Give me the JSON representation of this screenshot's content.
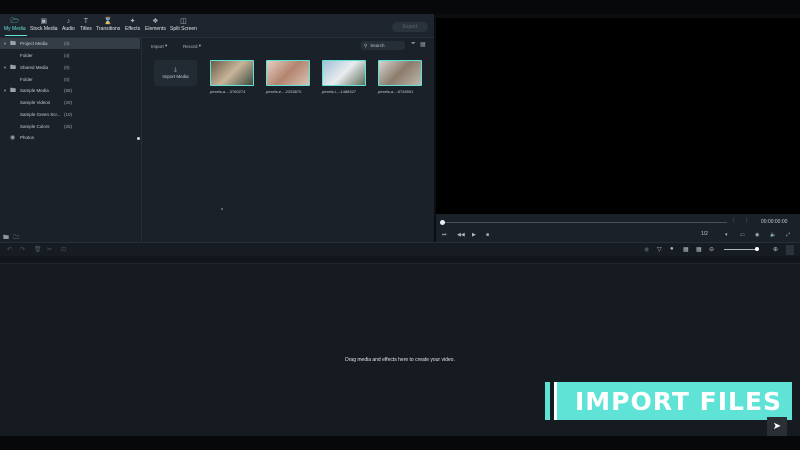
{
  "tabs": [
    {
      "label": "My Media",
      "icon": "folder-icon"
    },
    {
      "label": "Stock Media",
      "icon": "film-icon"
    },
    {
      "label": "Audio",
      "icon": "music-note-icon"
    },
    {
      "label": "Titles",
      "icon": "text-icon"
    },
    {
      "label": "Transitions",
      "icon": "transition-icon"
    },
    {
      "label": "Effects",
      "icon": "effects-icon"
    },
    {
      "label": "Elements",
      "icon": "elements-icon"
    },
    {
      "label": "Split Screen",
      "icon": "split-screen-icon"
    }
  ],
  "export_label": "Export",
  "tree": [
    {
      "label": "Project Media",
      "count": "(4)",
      "selected": true,
      "indent": 0
    },
    {
      "label": "Folder",
      "count": "(4)",
      "selected": false,
      "indent": 1
    },
    {
      "label": "Shared Media",
      "count": "(0)",
      "selected": false,
      "indent": 0
    },
    {
      "label": "Folder",
      "count": "(0)",
      "selected": false,
      "indent": 1
    },
    {
      "label": "Sample Media",
      "count": "(55)",
      "selected": false,
      "indent": 0
    },
    {
      "label": "Sample Videos",
      "count": "(20)",
      "selected": false,
      "indent": 1
    },
    {
      "label": "Sample Green Scr...",
      "count": "(10)",
      "selected": false,
      "indent": 1
    },
    {
      "label": "Sample Colors",
      "count": "(25)",
      "selected": false,
      "indent": 1
    },
    {
      "label": "Photos",
      "count": "",
      "selected": false,
      "indent": 0
    }
  ],
  "browser": {
    "import_label": "Import",
    "record_label": "Record",
    "search_placeholder": "Search",
    "import_tile_label": "Import Media",
    "items": [
      {
        "label": "pexels-a...-3760274",
        "colors": [
          "#6b5a48",
          "#c8b59a",
          "#3e4a3f"
        ]
      },
      {
        "label": "pexels-e...-2253870",
        "colors": [
          "#e6d0c3",
          "#b3846f",
          "#d9c2b4"
        ]
      },
      {
        "label": "pexels-l...-1488327",
        "colors": [
          "#9fc1d6",
          "#e9ecef",
          "#5e6e5a"
        ]
      },
      {
        "label": "pexels-a...-6745901",
        "colors": [
          "#d7d4cf",
          "#8c7c6c",
          "#bfb8ae"
        ]
      }
    ]
  },
  "player": {
    "timecode": "00:00:00:00",
    "ratio": "1/2",
    "progress": 0
  },
  "timeline": {
    "drag_hint": "Drag media and effects here to create your video.",
    "zoom_level": 0.9
  },
  "overlay": {
    "banner_text": "IMPORT FILES"
  },
  "colors": {
    "accent": "#5fe3d6",
    "panel": "#1b2129",
    "preview": "#000000"
  }
}
